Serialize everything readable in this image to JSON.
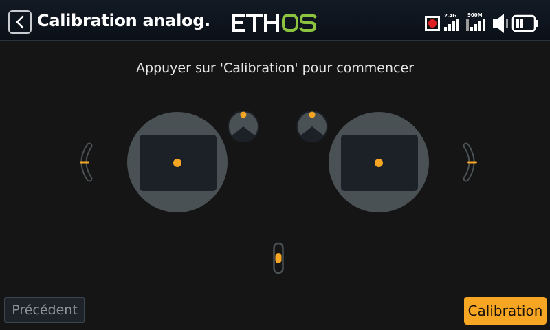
{
  "header": {
    "back_icon": "chevron-left-icon",
    "title": "Calibration analog.",
    "logo_text": "ETHOS",
    "logo_colors": {
      "eth": "#ffffff",
      "os": "#8cc43f"
    }
  },
  "status": {
    "rf_24_label": "2.4G",
    "rf_900_label": "900M",
    "record_icon": "record-icon",
    "speaker_icon": "speaker-icon",
    "battery_icon": "battery-icon"
  },
  "main": {
    "instruction": "Appuyer sur 'Calibration' pour commencer"
  },
  "controls": {
    "left_stick": {
      "x": 0,
      "y": 0
    },
    "right_stick": {
      "x": 0,
      "y": 0
    },
    "pot1": 0,
    "pot2": 0,
    "left_slider": 0,
    "right_slider": 0,
    "center_slider": 0
  },
  "footer": {
    "previous_label": "Précédent",
    "calibration_label": "Calibration"
  },
  "colors": {
    "accent": "#f6a623",
    "gimbal": "#4a5155",
    "pad": "#1c2127",
    "background": "#151515"
  }
}
